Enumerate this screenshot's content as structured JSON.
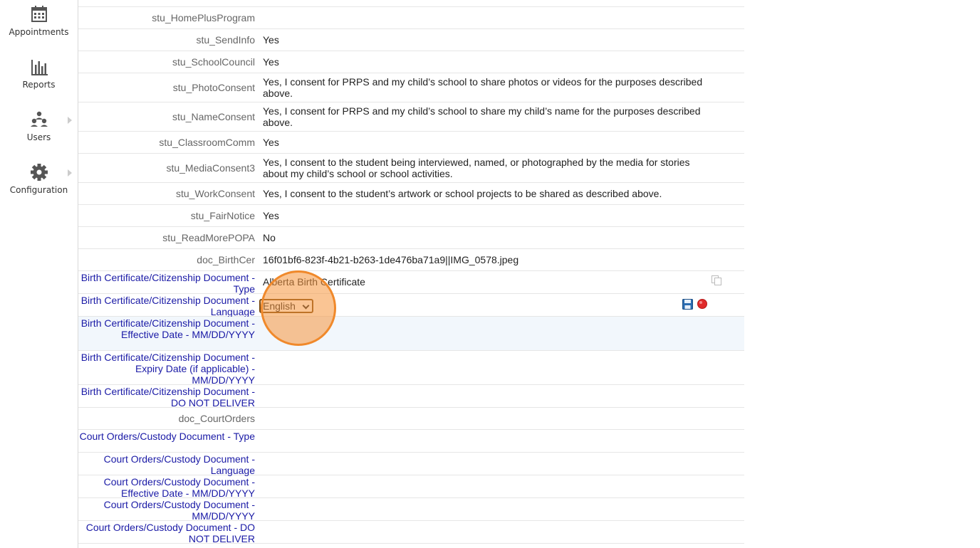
{
  "sidebar": {
    "items": [
      {
        "label": "Appointments",
        "icon": "calendar-icon"
      },
      {
        "label": "Reports",
        "icon": "bar-chart-icon"
      },
      {
        "label": "Users",
        "icon": "users-icon"
      },
      {
        "label": "Configuration",
        "icon": "gear-icon"
      }
    ]
  },
  "fields": [
    {
      "label": "stu_HomePlusProgram",
      "value": ""
    },
    {
      "label": "stu_SendInfo",
      "value": "Yes"
    },
    {
      "label": "stu_SchoolCouncil",
      "value": "Yes"
    },
    {
      "label": "stu_PhotoConsent",
      "value": "Yes, I consent for PRPS and my child’s school to share photos or videos for the purposes described above."
    },
    {
      "label": "stu_NameConsent",
      "value": "Yes, I consent for PRPS and my child’s school to share my child’s name for the purposes described above."
    },
    {
      "label": "stu_ClassroomComm",
      "value": "Yes"
    },
    {
      "label": "stu_MediaConsent3",
      "value": "Yes, I consent to the student being interviewed, named, or photographed by the media for stories about my child’s school or school activities."
    },
    {
      "label": "stu_WorkConsent",
      "value": "Yes, I consent to the student’s artwork or school projects to be shared as described above."
    },
    {
      "label": "stu_FairNotice",
      "value": "Yes"
    },
    {
      "label": "stu_ReadMorePOPA",
      "value": "No"
    },
    {
      "label": "doc_BirthCer",
      "value": "16f01bf6-823f-4b21-b263-1de476ba71a9||IMG_0578.jpeg"
    },
    {
      "label": "Birth Certificate/Citizenship Document - Type",
      "value": "Alberta Birth Certificate"
    },
    {
      "label": "Birth Certificate/Citizenship Document - Language",
      "value": ""
    },
    {
      "label": "Birth Certificate/Citizenship Document - Effective Date - MM/DD/YYYY",
      "value": ""
    },
    {
      "label": "Birth Certificate/Citizenship Document - Expiry Date (if applicable) - MM/DD/YYYY",
      "value": ""
    },
    {
      "label": "Birth Certificate/Citizenship Document - DO NOT DELIVER",
      "value": ""
    },
    {
      "label": "doc_CourtOrders",
      "value": ""
    },
    {
      "label": "Court Orders/Custody Document - Type",
      "value": ""
    },
    {
      "label": "Court Orders/Custody Document - Language",
      "value": ""
    },
    {
      "label": "Court Orders/Custody Document - Effective Date - MM/DD/YYYY",
      "value": ""
    },
    {
      "label": "Court Orders/Custody Document - MM/DD/YYYY",
      "value": ""
    },
    {
      "label": "Court Orders/Custody Document - DO NOT DELIVER",
      "value": ""
    }
  ],
  "language_select": {
    "selected": "English"
  },
  "colors": {
    "link_label": "#1a1aa6",
    "accent_ring": "#f0892b",
    "save": "#2b6cb0",
    "cancel": "#e02b2b"
  }
}
